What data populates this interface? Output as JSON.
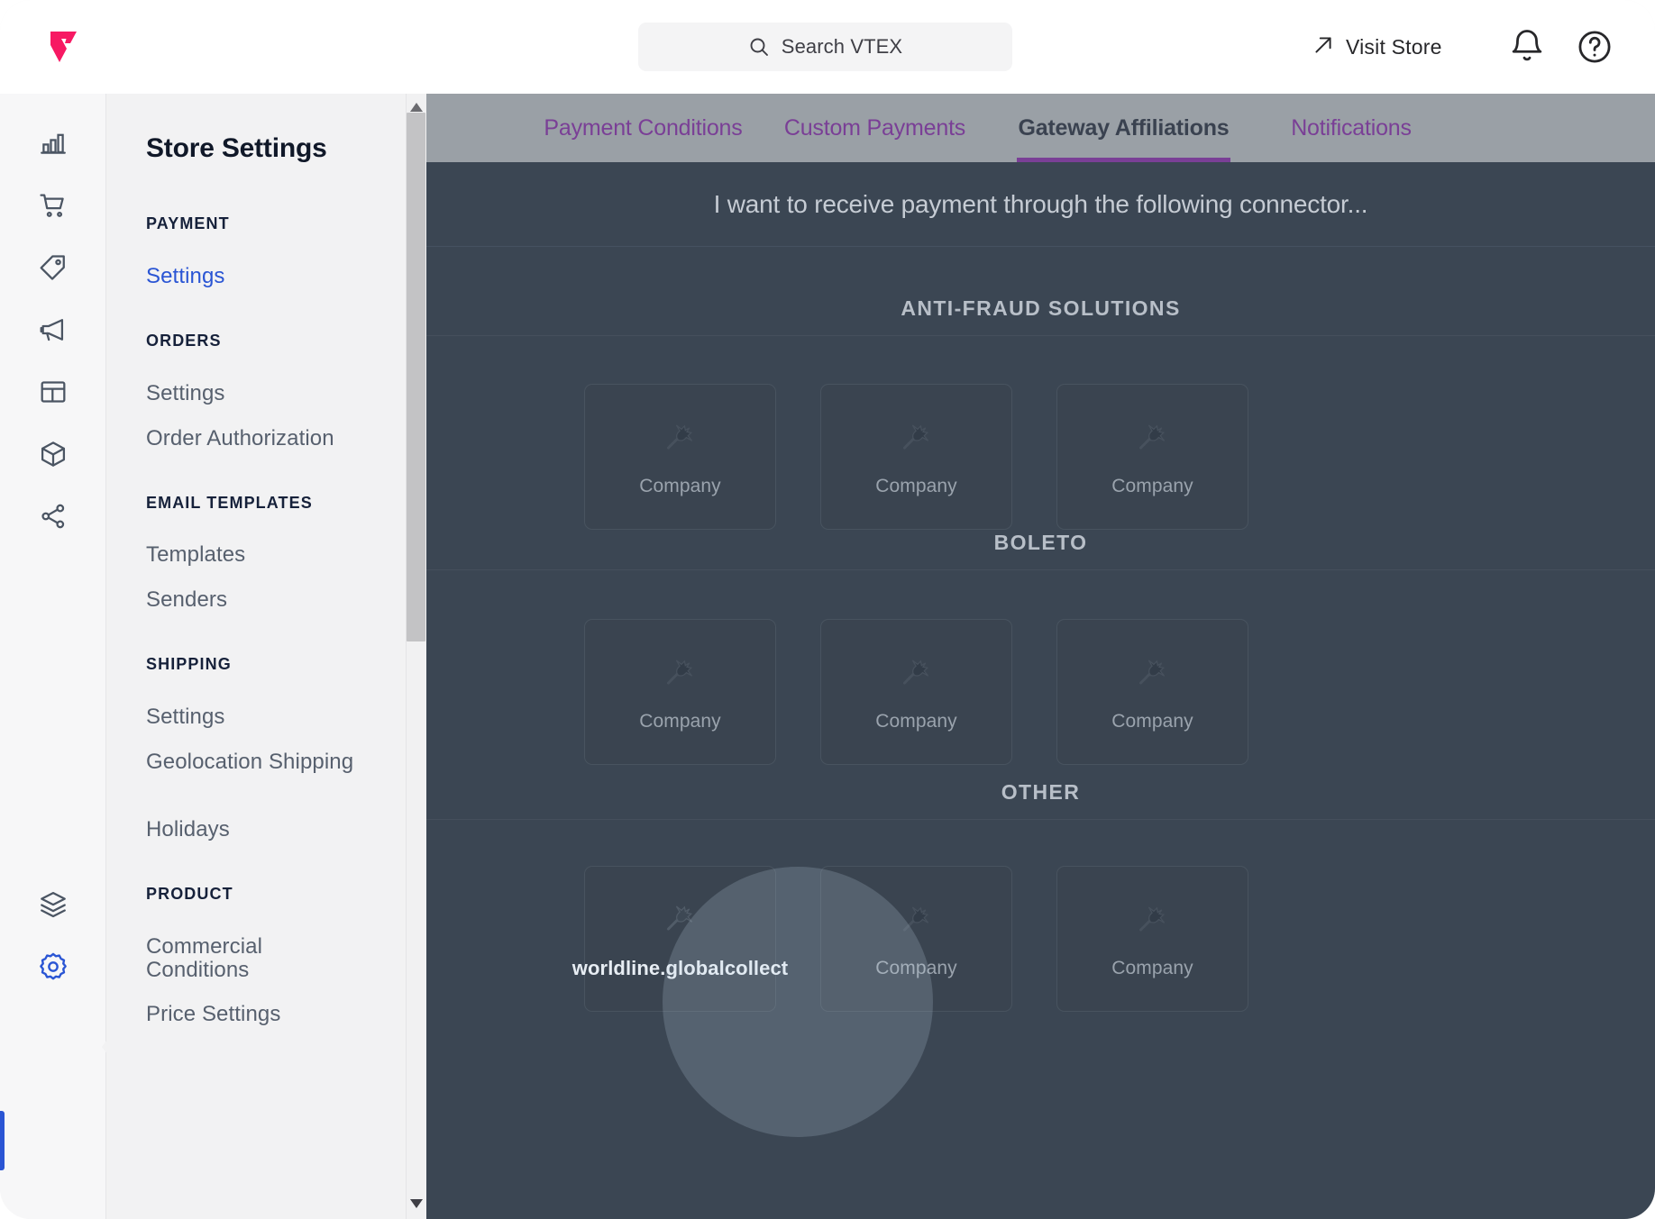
{
  "topbar": {
    "logo_icon": "vtex-logo-icon",
    "search": {
      "placeholder": "Search VTEX",
      "icon": "search-icon"
    },
    "visit_store": {
      "label": "Visit Store",
      "icon": "external-link-arrow-icon"
    },
    "notifications_icon": "bell-icon",
    "help_icon": "help-circle-icon"
  },
  "rail": {
    "items": [
      {
        "name": "analytics-icon"
      },
      {
        "name": "cart-icon"
      },
      {
        "name": "tag-icon"
      },
      {
        "name": "megaphone-icon"
      },
      {
        "name": "layout-icon"
      },
      {
        "name": "box-icon"
      },
      {
        "name": "share-icon"
      },
      {
        "name": "layers-icon"
      },
      {
        "name": "gear-icon"
      }
    ],
    "active_item": "gear-icon"
  },
  "sidebar": {
    "title": "Store Settings",
    "groups": [
      {
        "label": "PAYMENT",
        "items": [
          {
            "label": "Settings",
            "active": true
          }
        ]
      },
      {
        "label": "ORDERS",
        "items": [
          {
            "label": "Settings"
          },
          {
            "label": "Order Authorization"
          }
        ]
      },
      {
        "label": "EMAIL TEMPLATES",
        "items": [
          {
            "label": "Templates"
          },
          {
            "label": "Senders"
          }
        ]
      },
      {
        "label": "SHIPPING",
        "items": [
          {
            "label": "Settings"
          },
          {
            "label": "Geolocation Shipping"
          },
          {
            "label": "Holidays"
          }
        ]
      },
      {
        "label": "PRODUCT",
        "items": [
          {
            "label": "Commercial Conditions"
          },
          {
            "label": "Price Settings"
          }
        ]
      }
    ],
    "scrollbar": {
      "up_icon": "scroll-up-arrow-icon",
      "down_icon": "scroll-down-arrow-icon"
    }
  },
  "main": {
    "tabs": [
      {
        "label": "Payment Conditions",
        "active": false
      },
      {
        "label": "Custom Payments",
        "active": false
      },
      {
        "label": "Gateway Affiliations",
        "active": true
      },
      {
        "label": "Notifications",
        "active": false
      }
    ],
    "headline": "I want to receive payment through the following connector...",
    "sections": [
      {
        "heading": "ANTI-FRAUD SOLUTIONS",
        "cards": [
          {
            "label": "Company",
            "icon": "plug-icon",
            "highlighted": false
          },
          {
            "label": "Company",
            "icon": "plug-icon",
            "highlighted": false
          },
          {
            "label": "Company",
            "icon": "plug-icon",
            "highlighted": false
          }
        ]
      },
      {
        "heading": "BOLETO",
        "cards": [
          {
            "label": "Company",
            "icon": "plug-icon",
            "highlighted": false
          },
          {
            "label": "Company",
            "icon": "plug-icon",
            "highlighted": false
          },
          {
            "label": "Company",
            "icon": "plug-icon",
            "highlighted": false
          }
        ]
      },
      {
        "heading": "OTHER",
        "cards": [
          {
            "label": "worldline.globalcollect",
            "icon": "plug-icon",
            "highlighted": true
          },
          {
            "label": "Company",
            "icon": "plug-icon",
            "highlighted": false
          },
          {
            "label": "Company",
            "icon": "plug-icon",
            "highlighted": false
          }
        ]
      }
    ]
  },
  "colors": {
    "brand_pink": "#f71963",
    "accent_blue": "#2a55d4",
    "tab_purple": "#7a3f96",
    "content_bg": "#3b4653",
    "tabbar_overlay": "#9aa0a6"
  }
}
